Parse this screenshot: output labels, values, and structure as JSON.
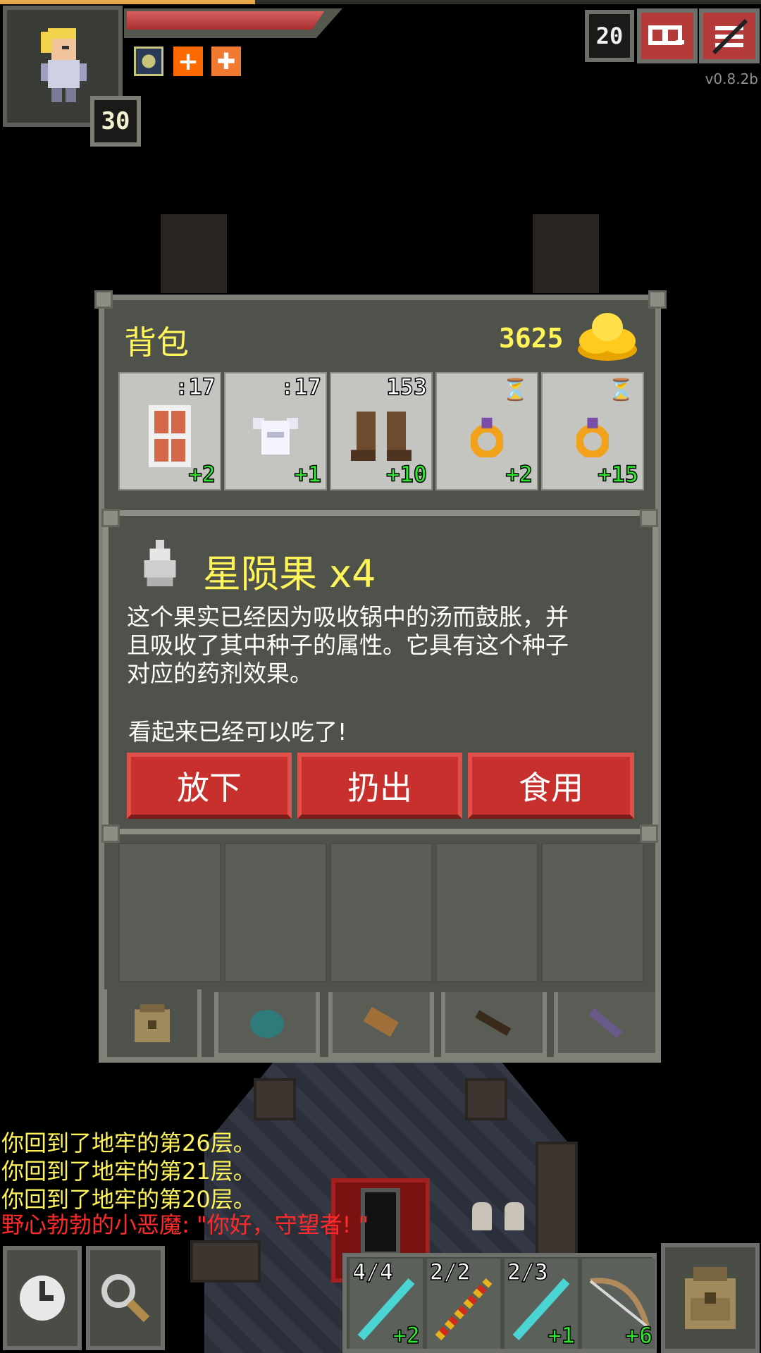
{
  "hud": {
    "hero_level": "30",
    "depth": "20",
    "version": "v0.8.2b",
    "buffs": [
      "light-buff-icon",
      "regeneration-icon",
      "haste-icon"
    ],
    "colors": {
      "hp": "#c23b3b",
      "xp": "#e8a94a"
    }
  },
  "backpack": {
    "title": "背包",
    "gold": "3625",
    "slots": [
      {
        "icon": "shield-icon",
        "qty": ":17",
        "level": "+2"
      },
      {
        "icon": "armor-icon",
        "qty": ":17",
        "level": "+1"
      },
      {
        "icon": "boots-icon",
        "qty": "153",
        "level": "+10"
      },
      {
        "icon": "ring-icon",
        "qty": "",
        "level": "+2",
        "unidentified": true
      },
      {
        "icon": "ring-icon",
        "qty": "",
        "level": "+15",
        "unidentified": true
      }
    ],
    "tabs": [
      "backpack-icon",
      "seed-pouch-icon",
      "scroll-holder-icon",
      "wand-holster-icon",
      "magic-holster-icon"
    ]
  },
  "item_dialog": {
    "title": "星陨果 x4",
    "description": "这个果实已经因为吸收锅中的汤而鼓胀，并\n且吸收了其中种子的属性。它具有这个种子\n对应的药剂效果。",
    "note": "看起来已经可以吃了!",
    "actions": {
      "drop": "放下",
      "throw": "扔出",
      "eat": "食用"
    }
  },
  "log": [
    {
      "text": "你回到了地牢的第26层。",
      "color": "yellow"
    },
    {
      "text": "你回到了地牢的第21层。",
      "color": "yellow"
    },
    {
      "text": "你回到了地牢的第20层。",
      "color": "yellow"
    },
    {
      "text": "野心勃勃的小恶魔: \"你好，守望者! \"",
      "color": "red"
    }
  ],
  "quickslots": [
    {
      "icon": "wand-icon",
      "charges": "4/4",
      "level": "+2"
    },
    {
      "icon": "wand-of-fire-icon",
      "charges": "2/2",
      "level": ""
    },
    {
      "icon": "wand-icon",
      "charges": "2/3",
      "level": "+1"
    },
    {
      "icon": "bow-icon",
      "charges": "",
      "level": "+6"
    }
  ]
}
